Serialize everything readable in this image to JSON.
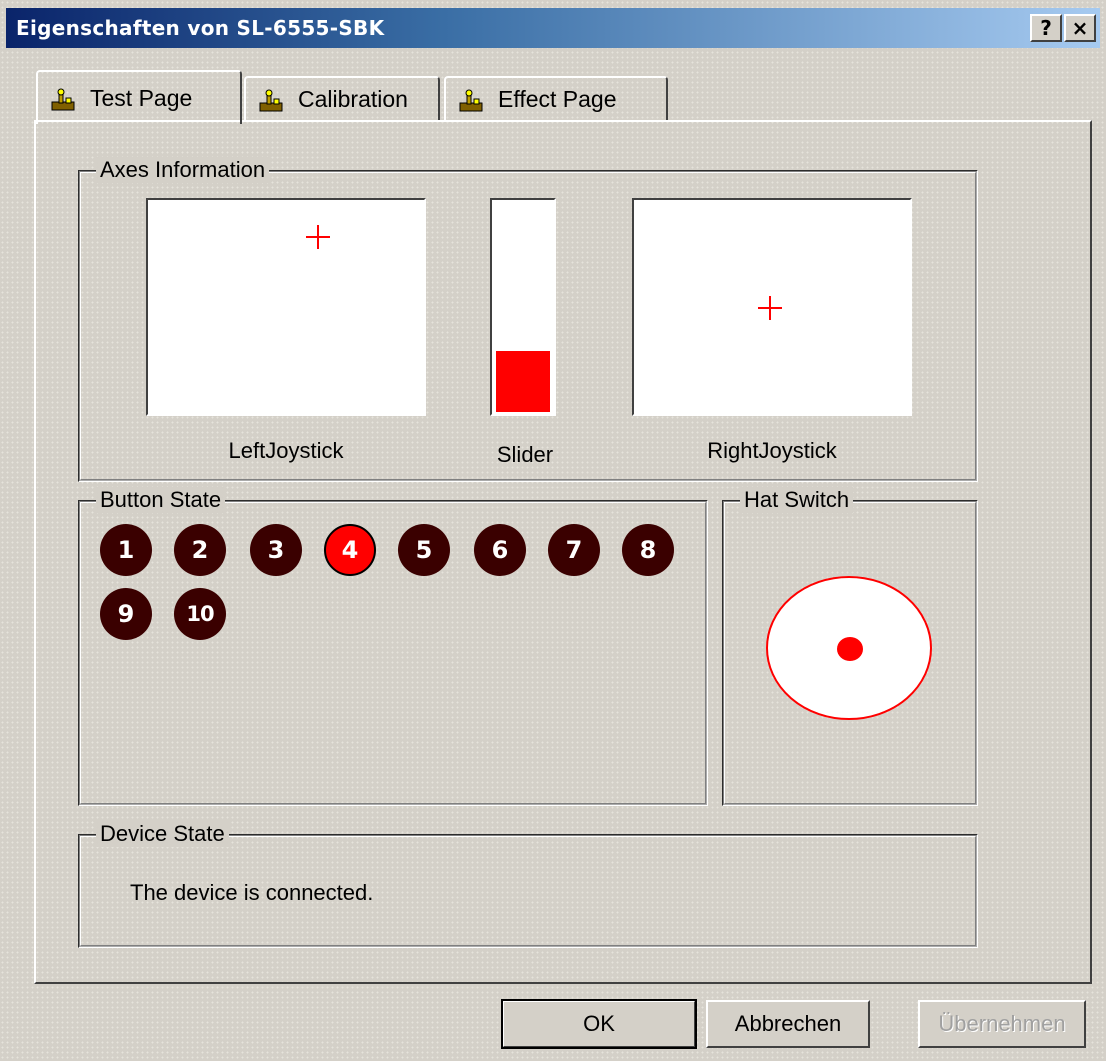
{
  "window": {
    "title": "Eigenschaften von SL-6555-SBK",
    "help_label": "?",
    "close_label": "×"
  },
  "tabs": [
    {
      "label": "Test Page",
      "icon": "joystick-icon",
      "active": true
    },
    {
      "label": "Calibration",
      "icon": "joystick-icon",
      "active": false
    },
    {
      "label": "Effect Page",
      "icon": "joystick-icon",
      "active": false
    }
  ],
  "axes": {
    "label": "Axes Information",
    "left_joystick_label": "LeftJoystick",
    "slider_label": "Slider",
    "right_joystick_label": "RightJoystick",
    "slider_fill_fraction": 0.29,
    "crosshair_color": "#ff0000"
  },
  "button_state": {
    "label": "Button State",
    "buttons": [
      {
        "label": "1",
        "pressed": false
      },
      {
        "label": "2",
        "pressed": false
      },
      {
        "label": "3",
        "pressed": false
      },
      {
        "label": "4",
        "pressed": true
      },
      {
        "label": "5",
        "pressed": false
      },
      {
        "label": "6",
        "pressed": false
      },
      {
        "label": "7",
        "pressed": false
      },
      {
        "label": "8",
        "pressed": false
      },
      {
        "label": "9",
        "pressed": false
      },
      {
        "label": "10",
        "pressed": false
      }
    ],
    "pressed_color": "#ff0000",
    "released_color": "#3a0000"
  },
  "hat_switch": {
    "label": "Hat Switch"
  },
  "device_state": {
    "label": "Device State",
    "message": "The device is connected."
  },
  "footer": {
    "ok_label": "OK",
    "cancel_label": "Abbrechen",
    "apply_label": "Übernehmen"
  }
}
